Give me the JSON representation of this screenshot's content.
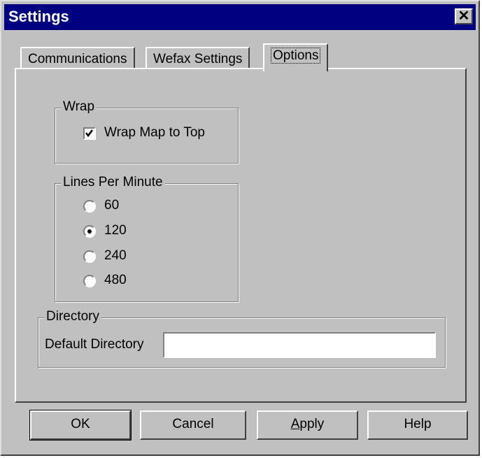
{
  "window": {
    "title": "Settings",
    "close_glyph": "✕"
  },
  "tabs": [
    {
      "label": "Communications",
      "active": false
    },
    {
      "label": "Wefax Settings",
      "active": false
    },
    {
      "label": "Options",
      "active": true
    }
  ],
  "wrap_group": {
    "legend": "Wrap",
    "checkbox": {
      "label": "Wrap Map to Top",
      "checked": true
    }
  },
  "lpm_group": {
    "legend": "Lines Per Minute",
    "options": [
      {
        "label": "60",
        "selected": false
      },
      {
        "label": "120",
        "selected": true
      },
      {
        "label": "240",
        "selected": false
      },
      {
        "label": "480",
        "selected": false
      }
    ]
  },
  "directory_group": {
    "legend": "Directory",
    "field_label": "Default Directory",
    "field_value": ""
  },
  "buttons": {
    "ok": "OK",
    "cancel": "Cancel",
    "apply_first": "A",
    "apply_rest": "pply",
    "help": "Help"
  }
}
